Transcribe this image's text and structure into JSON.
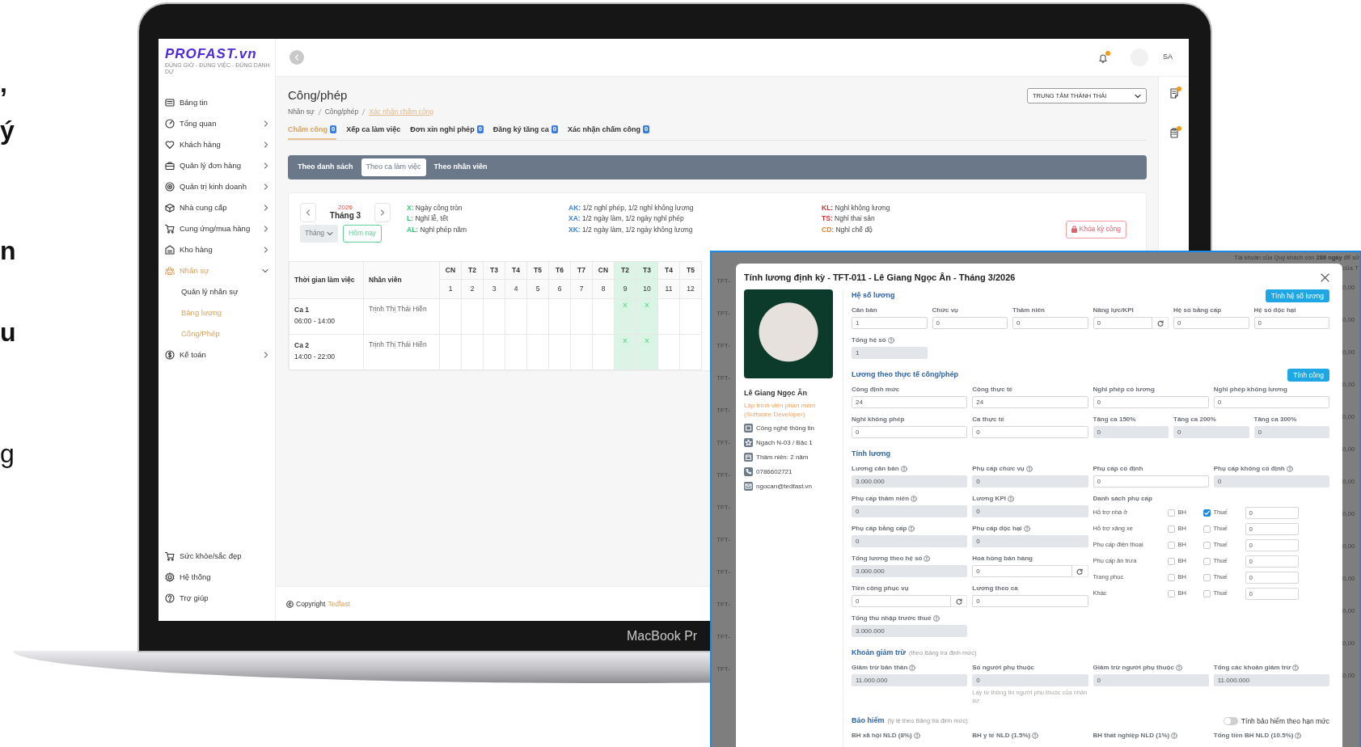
{
  "promo_fragments": [
    {
      "text": ",",
      "bold": true
    },
    {
      "text": "ý",
      "bold": true
    },
    {
      "text": "n",
      "bold": true
    },
    {
      "text": "u",
      "bold": true
    },
    {
      "text": "g",
      "bold": false
    }
  ],
  "laptop": {
    "label": "MacBook Pr"
  },
  "app": {
    "logo": {
      "name": "PROFAST.vn",
      "tagline": "ĐÚNG GIỜ - ĐÚNG VIỆC - ĐÚNG DANH DỰ"
    },
    "sidebar": {
      "items": [
        {
          "label": "Bảng tin",
          "has_submenu": false,
          "expanded": false,
          "selected": false
        },
        {
          "label": "Tổng quan",
          "has_submenu": true,
          "expanded": false,
          "selected": false
        },
        {
          "label": "Khách hàng",
          "has_submenu": true,
          "expanded": false,
          "selected": false
        },
        {
          "label": "Quản lý đơn hàng",
          "has_submenu": true,
          "expanded": false,
          "selected": false
        },
        {
          "label": "Quản trị kinh doanh",
          "has_submenu": true,
          "expanded": false,
          "selected": false
        },
        {
          "label": "Nhà cung cấp",
          "has_submenu": true,
          "expanded": false,
          "selected": false
        },
        {
          "label": "Cung ứng/mua hàng",
          "has_submenu": true,
          "expanded": false,
          "selected": false
        },
        {
          "label": "Kho hàng",
          "has_submenu": true,
          "expanded": false,
          "selected": false
        },
        {
          "label": "Nhân sự",
          "has_submenu": true,
          "expanded": true,
          "selected": true,
          "children": [
            {
              "label": "Quản lý nhân sự",
              "selected": false
            },
            {
              "label": "Bảng lương",
              "selected": true
            },
            {
              "label": "Công/Phép",
              "selected": true
            }
          ]
        },
        {
          "label": "Kế toán",
          "has_submenu": true,
          "expanded": false,
          "selected": false
        }
      ],
      "bottom_items": [
        {
          "label": "Sức khỏe/sắc đẹp"
        },
        {
          "label": "Hệ thống"
        },
        {
          "label": "Trợ giúp"
        }
      ]
    },
    "topbar": {
      "bell_alert": true,
      "avatar_initials": "SA"
    },
    "rail": [
      {
        "alert": true
      },
      {
        "alert": true
      }
    ],
    "page": {
      "title": "Công/phép",
      "breadcrumb": [
        {
          "label": "Nhân sự",
          "current": false
        },
        {
          "label": "Công/phép",
          "current": false
        },
        {
          "label": "Xác nhận chấm công",
          "current": true
        }
      ],
      "branch_select": "TRUNG TÂM THÀNH THÁI",
      "tabs": [
        {
          "label": "Chấm công",
          "badge": "0",
          "selected": true
        },
        {
          "label": "Xếp ca làm việc",
          "selected": false
        },
        {
          "label": "Đơn xin nghỉ phép",
          "badge": "0",
          "selected": false
        },
        {
          "label": "Đăng ký tăng ca",
          "badge": "0",
          "selected": false
        },
        {
          "label": "Xác nhận chấm công",
          "badge": "0",
          "selected": false
        }
      ],
      "views": [
        {
          "label": "Theo danh sách",
          "selected": false
        },
        {
          "label": "Theo ca làm việc",
          "selected": true
        },
        {
          "label": "Theo nhân viên",
          "selected": false
        }
      ],
      "calendar": {
        "year": "2026",
        "month": "Tháng 3",
        "period_select": "Tháng",
        "today_button": "Hôm nay",
        "legend": [
          {
            "code": "X:",
            "text": "Ngày công tròn",
            "color": "#2ecc71"
          },
          {
            "code": "L:",
            "text": "Nghỉ lễ, tết",
            "color": "#2ecc71"
          },
          {
            "code": "AL:",
            "text": "Nghỉ phép năm",
            "color": "#2ecc71"
          },
          {
            "code": "AK:",
            "text": "1/2 nghỉ phép, 1/2 nghỉ không lương",
            "color": "#3b7ddd"
          },
          {
            "code": "XA:",
            "text": "1/2 ngày làm, 1/2 ngày nghỉ phép",
            "color": "#3b7ddd"
          },
          {
            "code": "XK:",
            "text": "1/2 ngày làm, 1/2 ngày không lương",
            "color": "#3b7ddd"
          },
          {
            "code": "KL:",
            "text": "Nghỉ không lương",
            "color": "#d63031"
          },
          {
            "code": "TS:",
            "text": "Nghỉ thai sản",
            "color": "#d63031"
          },
          {
            "code": "CD:",
            "text": "Nghỉ chế độ",
            "color": "#e67e22"
          }
        ],
        "lock_button": "Khóa kỳ công",
        "table": {
          "columns": [
            "Thời gian làm việc",
            "Nhân viên"
          ],
          "days": [
            {
              "dow": "CN",
              "day": "1",
              "highlight": false
            },
            {
              "dow": "T2",
              "day": "2",
              "highlight": false
            },
            {
              "dow": "T3",
              "day": "3",
              "highlight": false
            },
            {
              "dow": "T4",
              "day": "4",
              "highlight": false
            },
            {
              "dow": "T5",
              "day": "5",
              "highlight": false
            },
            {
              "dow": "T6",
              "day": "6",
              "highlight": false
            },
            {
              "dow": "T7",
              "day": "7",
              "highlight": false
            },
            {
              "dow": "CN",
              "day": "8",
              "highlight": false
            },
            {
              "dow": "T2",
              "day": "9",
              "highlight": true
            },
            {
              "dow": "T3",
              "day": "10",
              "highlight": true
            },
            {
              "dow": "T4",
              "day": "11",
              "highlight": false
            },
            {
              "dow": "T5",
              "day": "12",
              "highlight": false
            }
          ],
          "rows": [
            {
              "shift": "Ca 1",
              "time": "06:00 - 14:00",
              "employee": "Trịnh Thị Thái Hiền",
              "cells": [
                {
                  "marked": false
                },
                {
                  "marked": false
                },
                {
                  "marked": false
                },
                {
                  "marked": false
                },
                {
                  "marked": false
                },
                {
                  "marked": false
                },
                {
                  "marked": false
                },
                {
                  "marked": false
                },
                {
                  "marked": true,
                  "text": "X"
                },
                {
                  "marked": true,
                  "text": "X"
                },
                {
                  "marked": false
                },
                {
                  "marked": false
                }
              ]
            },
            {
              "shift": "Ca 2",
              "time": "14:00 - 22:00",
              "employee": "Trịnh Thị Thái Hiền",
              "cells": [
                {
                  "marked": false
                },
                {
                  "marked": false
                },
                {
                  "marked": false
                },
                {
                  "marked": false
                },
                {
                  "marked": false
                },
                {
                  "marked": false
                },
                {
                  "marked": false
                },
                {
                  "marked": false
                },
                {
                  "marked": true,
                  "text": "X"
                },
                {
                  "marked": true,
                  "text": "X"
                },
                {
                  "marked": false
                },
                {
                  "marked": false
                }
              ]
            }
          ]
        }
      },
      "footer": {
        "text": "Copyright",
        "link": "Tedfast"
      }
    }
  },
  "payroll_dialog": {
    "notice": "Tài khoản của Quý khách còn **286 ngày** để sử",
    "notice_cont": "của T",
    "background_rows": [
      {
        "code": "TFT-",
        "amount": "0,00"
      },
      {
        "code": "TFT-",
        "amount": "0,00"
      },
      {
        "code": "TFT-",
        "amount": "0,00"
      },
      {
        "code": "TFT-",
        "amount": "0,00"
      },
      {
        "code": "TFT-",
        "amount": "0,00"
      },
      {
        "code": "TFT-",
        "amount": "0,00"
      },
      {
        "code": "TFT-",
        "amount": "0,00"
      },
      {
        "code": "TFT-",
        "amount": "0,00"
      },
      {
        "code": "TFT-",
        "amount": "0,00"
      },
      {
        "code": "TFT-",
        "amount": "0,00"
      },
      {
        "code": "TFT-",
        "amount": "0,00"
      },
      {
        "code": "TFT-",
        "amount": "0,00"
      },
      {
        "code": "TFT-",
        "amount": "0,00"
      }
    ],
    "title": "Tính lương định kỳ - TFT-011 - Lê Giang Ngọc Ân - Tháng 3/2026",
    "profile": {
      "name": "Lê Giang Ngọc Ân",
      "role": "Lập trình viên phần mềm (Software Developer)",
      "details": [
        "Công nghệ thông tin",
        "Ngạch N-03 / Bậc 1",
        "Thâm niên: 2 năm",
        "0786602721",
        "ngocan@tedfast.vn"
      ]
    },
    "sections": [
      {
        "kind": "coefficients",
        "title": "Hệ số lương",
        "button": "Tính hệ số lương",
        "rows": [
          [
            {
              "label": "Căn bản",
              "value": "1",
              "info": false,
              "readonly": false,
              "refresh": false
            },
            {
              "label": "Chức vụ",
              "value": "0",
              "info": false,
              "readonly": false,
              "refresh": false
            },
            {
              "label": "Thâm niên",
              "value": "0",
              "info": false,
              "readonly": false,
              "refresh": false
            },
            {
              "label": "Năng lực/KPI",
              "value": "0",
              "info": false,
              "readonly": false,
              "refresh": true
            },
            {
              "label": "Hệ số bằng cấp",
              "value": "0",
              "info": false,
              "readonly": false,
              "refresh": false
            },
            {
              "label": "Hệ số độc hại",
              "value": "0",
              "info": false,
              "readonly": false,
              "refresh": false
            }
          ],
          [
            {
              "label": "Tổng hệ số",
              "value": "1",
              "info": true,
              "readonly": true,
              "refresh": false
            }
          ]
        ]
      },
      {
        "kind": "attendance",
        "title": "Lương theo thực tế công/phép",
        "button": "Tính công",
        "rows": [
          [
            {
              "label": "Công định mức",
              "value": "24",
              "info": false,
              "readonly": false,
              "refresh": false
            },
            {
              "label": "Công thực tế",
              "value": "24",
              "info": false,
              "readonly": false,
              "refresh": false
            },
            {
              "label": "Nghỉ phép có lương",
              "value": "0",
              "info": false,
              "readonly": false,
              "refresh": false
            },
            {
              "label": "Nghỉ phép không lương",
              "value": "0",
              "info": false,
              "readonly": false,
              "refresh": false
            }
          ],
          [
            {
              "label": "Nghỉ không phép",
              "value": "0",
              "info": false,
              "readonly": false,
              "refresh": false
            },
            {
              "label": "Ca thực tế",
              "value": "0",
              "info": false,
              "readonly": false,
              "refresh": false
            }
          ]
        ],
        "overtime": [
          {
            "label": "Tăng ca 150%",
            "value": "0",
            "info": false,
            "readonly": true,
            "refresh": false
          },
          {
            "label": "Tăng ca 200%",
            "value": "0",
            "info": false,
            "readonly": true,
            "refresh": false
          },
          {
            "label": "Tăng ca 300%",
            "value": "0",
            "info": false,
            "readonly": true,
            "refresh": false
          }
        ]
      },
      {
        "kind": "salary",
        "title": "Tính lương",
        "rows": [
          [
            {
              "label": "Lương căn bản",
              "value": "3.000.000",
              "info": true,
              "readonly": true,
              "refresh": false
            },
            {
              "label": "Phụ cấp chức vụ",
              "value": "0",
              "info": true,
              "readonly": true,
              "refresh": false
            },
            {
              "label": "Phụ cấp cố định",
              "value": "0",
              "info": false,
              "readonly": false,
              "refresh": false
            },
            {
              "label": "Phụ cấp không cố định",
              "value": "0",
              "info": true,
              "readonly": true,
              "refresh": false
            }
          ]
        ],
        "left_rows": [
          [
            {
              "label": "Phụ cấp thâm niên",
              "value": "0",
              "info": true,
              "readonly": true,
              "refresh": false
            },
            {
              "label": "Lương KPI",
              "value": "0",
              "info": true,
              "readonly": true,
              "refresh": false
            }
          ],
          [
            {
              "label": "Phụ cấp bằng cấp",
              "value": "0",
              "info": true,
              "readonly": true,
              "refresh": false
            },
            {
              "label": "Phụ cấp độc hại",
              "value": "0",
              "info": true,
              "readonly": true,
              "refresh": false
            }
          ],
          [
            {
              "label": "Tổng lương theo hệ số",
              "value": "3.000.000",
              "info": true,
              "readonly": true,
              "refresh": false
            },
            {
              "label": "Hoa hồng bán hàng",
              "value": "0",
              "info": false,
              "readonly": false,
              "refresh": true
            }
          ],
          [
            {
              "label": "Tiền công phục vụ",
              "value": "0",
              "info": false,
              "readonly": false,
              "refresh": true
            },
            {
              "label": "Lương theo ca",
              "value": "0",
              "info": false,
              "readonly": false,
              "refresh": false
            }
          ],
          [
            {
              "label": "Tổng thu nhập trước thuế",
              "value": "3.000.000",
              "info": true,
              "readonly": true,
              "refresh": false
            }
          ]
        ],
        "allowances": {
          "title": "Danh sách phụ cấp",
          "items": [
            {
              "name": "Hỗ trợ nhà ở",
              "checks": [
                {
                  "label": "BH",
                  "checked": false
                },
                {
                  "label": "Thuế",
                  "checked": true
                }
              ],
              "value": "0"
            },
            {
              "name": "Hỗ trợ xăng xe",
              "checks": [
                {
                  "label": "BH",
                  "checked": false
                },
                {
                  "label": "Thuế",
                  "checked": false
                }
              ],
              "value": "0"
            },
            {
              "name": "Phụ cấp điện thoại",
              "checks": [
                {
                  "label": "BH",
                  "checked": false
                },
                {
                  "label": "Thuế",
                  "checked": false
                }
              ],
              "value": "0"
            },
            {
              "name": "Phụ cấp ăn trưa",
              "checks": [
                {
                  "label": "BH",
                  "checked": false
                },
                {
                  "label": "Thuế",
                  "checked": false
                }
              ],
              "value": "0"
            },
            {
              "name": "Trang phục",
              "checks": [
                {
                  "label": "BH",
                  "checked": false
                },
                {
                  "label": "Thuế",
                  "checked": false
                }
              ],
              "value": "0"
            },
            {
              "name": "Khác",
              "checks": [
                {
                  "label": "BH",
                  "checked": false
                },
                {
                  "label": "Thuế",
                  "checked": false
                }
              ],
              "value": "0"
            }
          ]
        }
      },
      {
        "kind": "deductions",
        "title": "Khoản giảm trừ",
        "note": "(theo Bảng tra định mức)",
        "rows": [
          [
            {
              "label": "Giảm trừ bản thân",
              "value": "11.000.000",
              "info": true,
              "readonly": true,
              "refresh": false
            },
            {
              "label": "Số người phụ thuộc",
              "value": "0",
              "info": false,
              "readonly": true,
              "refresh": false,
              "hint": "Lấy từ thông tin người phụ thuộc của nhân sự"
            },
            {
              "label": "Giảm trừ người phụ thuộc",
              "value": "0",
              "info": true,
              "readonly": true,
              "refresh": false
            },
            {
              "label": "Tổng các khoản giảm trừ",
              "value": "11.000.000",
              "info": true,
              "readonly": true,
              "refresh": false
            }
          ]
        ]
      },
      {
        "kind": "insurance",
        "title": "Bảo hiểm",
        "note": "(tỷ lệ theo Bảng tra định mức)",
        "toggle": {
          "label": "Tính bảo hiểm theo hạn mức",
          "on": false
        },
        "rows": [
          [
            {
              "label": "BH xã hội NLD (8%)",
              "info": true
            },
            {
              "label": "BH y tế NLD (1.5%)",
              "info": true
            },
            {
              "label": "BH thất nghiệp NLD (1%)",
              "info": true
            },
            {
              "label": "Tổng tiền BH NLD (10.5%)",
              "info": true
            }
          ]
        ]
      }
    ]
  }
}
